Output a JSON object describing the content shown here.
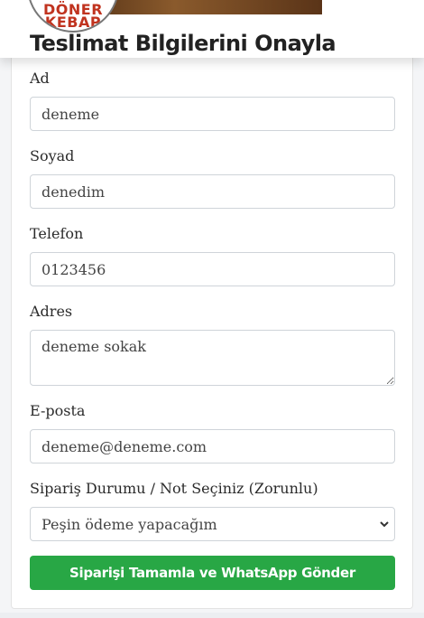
{
  "brand": {
    "logo_line1": "DÖNER",
    "logo_line2": "KEBAP"
  },
  "page": {
    "title": "Teslimat Bilgilerini Onayla"
  },
  "form": {
    "first_name": {
      "label": "Ad",
      "value": "deneme"
    },
    "last_name": {
      "label": "Soyad",
      "value": "denedim"
    },
    "phone": {
      "label": "Telefon",
      "value": "0123456"
    },
    "address": {
      "label": "Adres",
      "value": "deneme sokak"
    },
    "email": {
      "label": "E-posta",
      "value": "deneme@deneme.com"
    },
    "order_status": {
      "label": "Sipariş Durumu / Not Seçiniz (Zorunlu)",
      "selected": "Peşin ödeme yapacağım"
    },
    "submit_label": "Siparişi Tamamla ve WhatsApp Gönder"
  },
  "colors": {
    "submit": "#28a745",
    "logo_text": "#c0331f"
  }
}
